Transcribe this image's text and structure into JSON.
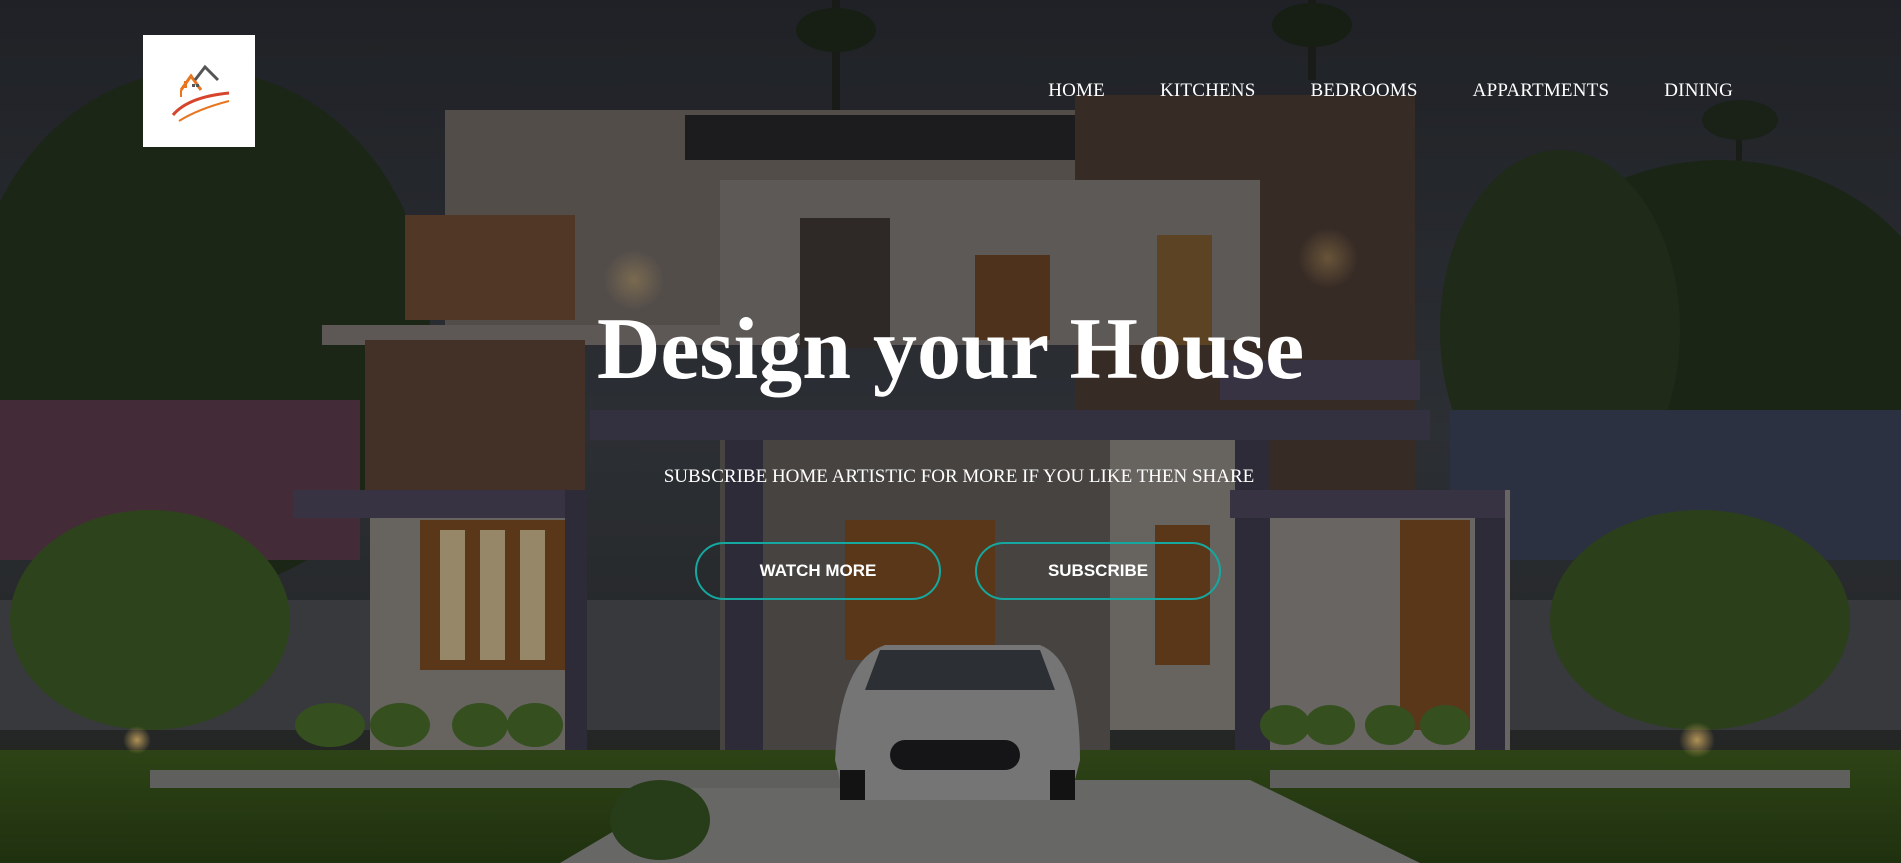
{
  "brand": {
    "logo_icon": "house-logo-icon"
  },
  "nav": {
    "items": [
      {
        "label": "HOME"
      },
      {
        "label": "KITCHENS"
      },
      {
        "label": "BEDROOMS"
      },
      {
        "label": "APPARTMENTS"
      },
      {
        "label": "DINING"
      }
    ]
  },
  "hero": {
    "title": "Design your House",
    "subtitle": "SUBSCRIBE HOME ARTISTIC FOR MORE IF YOU LIKE THEN SHARE",
    "buttons": {
      "watch_more": "WATCH MORE",
      "subscribe": "SUBSCRIBE"
    }
  },
  "colors": {
    "accent": "#15a8a0",
    "text": "#ffffff",
    "logo_orange": "#e8751f",
    "logo_red": "#d6452b"
  }
}
